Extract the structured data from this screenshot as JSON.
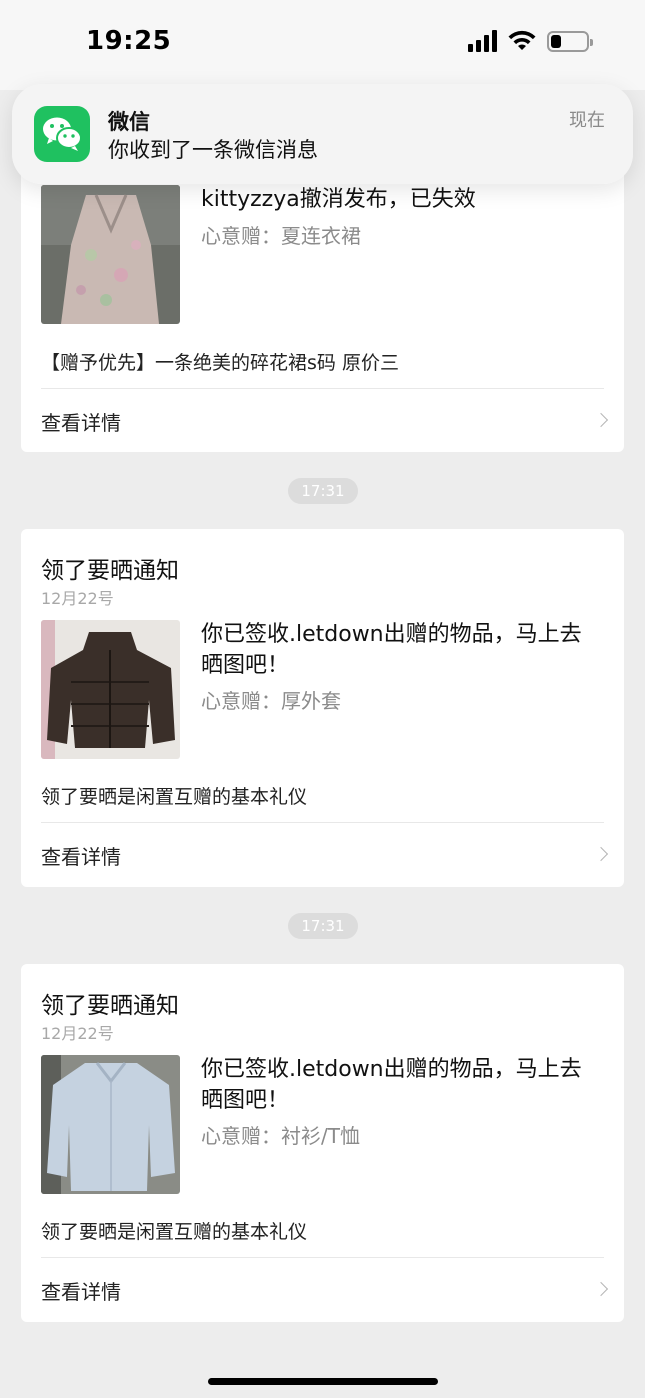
{
  "status_bar": {
    "time": "19:25",
    "signal_icon": "cellular-signal-icon",
    "wifi_icon": "wifi-icon",
    "battery_icon": "battery-icon",
    "battery_level": 0.3
  },
  "notification": {
    "app_name": "微信",
    "message": "你收到了一条微信消息",
    "time": "现在",
    "icon": "wechat-icon",
    "accent": "#1fc160"
  },
  "cards": [
    {
      "description": "kittyzzya撤消发布，已失效",
      "gift": "心意赠：夏连衣裙",
      "note": "【赠予优先】一条绝美的碎花裙s码 原价三",
      "detail_label": "查看详情",
      "thumb": "floral-dress-photo"
    },
    {
      "title": "领了要晒通知",
      "date": "12月22号",
      "description": "你已签收.letdown出赠的物品，马上去晒图吧！",
      "gift": "心意赠：厚外套",
      "note": "领了要晒是闲置互赠的基本礼仪",
      "detail_label": "查看详情",
      "thumb": "puffer-jacket-photo"
    },
    {
      "title": "领了要晒通知",
      "date": "12月22号",
      "description": "你已签收.letdown出赠的物品，马上去晒图吧！",
      "gift": "心意赠：衬衫/T恤",
      "note": "领了要晒是闲置互赠的基本礼仪",
      "detail_label": "查看详情",
      "thumb": "shirt-photo"
    }
  ],
  "time_separators": [
    "17:31",
    "17:31"
  ]
}
